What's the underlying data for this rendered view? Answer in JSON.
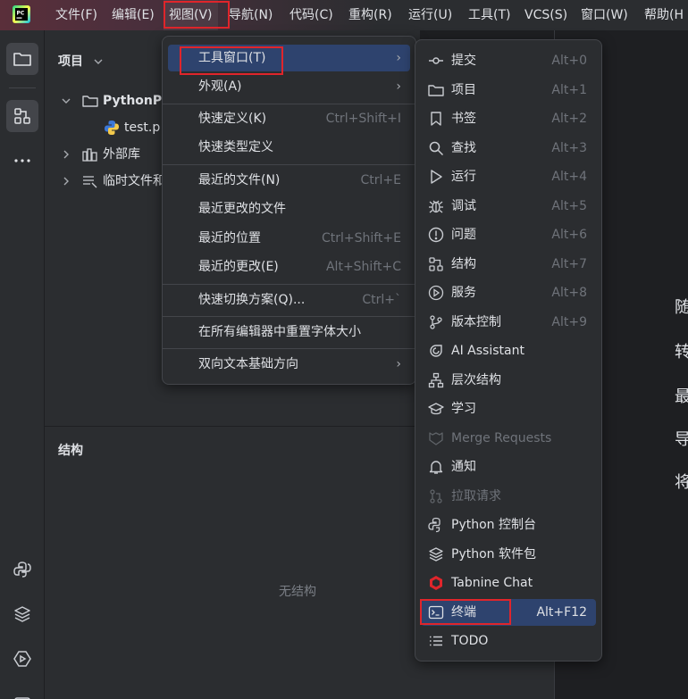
{
  "menubar": {
    "items": [
      "文件(F)",
      "编辑(E)",
      "视图(V)",
      "导航(N)",
      "代码(C)",
      "重构(R)",
      "运行(U)",
      "工具(T)",
      "VCS(S)",
      "窗口(W)",
      "帮助(H"
    ]
  },
  "project_panel": {
    "title": "项目",
    "tree": {
      "project_name": "PythonP",
      "file_name": "test.p",
      "external_libs": "外部库",
      "scratches": "临时文件和"
    }
  },
  "structure_panel": {
    "title": "结构",
    "empty_message": "无结构"
  },
  "editor_hints": [
    "随",
    "转",
    "最",
    "导",
    "将"
  ],
  "view_menu": {
    "items": [
      {
        "label": "工具窗口(T)",
        "shortcut": "",
        "submenu": true
      },
      {
        "label": "外观(A)",
        "shortcut": "",
        "submenu": true
      },
      {
        "label": "快速定义(K)",
        "shortcut": "Ctrl+Shift+I"
      },
      {
        "label": "快速类型定义",
        "shortcut": ""
      },
      {
        "label": "最近的文件(N)",
        "shortcut": "Ctrl+E"
      },
      {
        "label": "最近更改的文件",
        "shortcut": ""
      },
      {
        "label": "最近的位置",
        "shortcut": "Ctrl+Shift+E"
      },
      {
        "label": "最近的更改(E)",
        "shortcut": "Alt+Shift+C"
      },
      {
        "label": "快速切换方案(Q)...",
        "shortcut": "Ctrl+`"
      },
      {
        "label": "在所有编辑器中重置字体大小",
        "shortcut": ""
      },
      {
        "label": "双向文本基础方向",
        "shortcut": "",
        "submenu": true
      }
    ]
  },
  "tool_windows_menu": {
    "items": [
      {
        "label": "提交",
        "shortcut": "Alt+0",
        "icon": "commit-icon"
      },
      {
        "label": "项目",
        "shortcut": "Alt+1",
        "icon": "folder-icon"
      },
      {
        "label": "书签",
        "shortcut": "Alt+2",
        "icon": "bookmark-icon"
      },
      {
        "label": "查找",
        "shortcut": "Alt+3",
        "icon": "search-icon"
      },
      {
        "label": "运行",
        "shortcut": "Alt+4",
        "icon": "run-icon"
      },
      {
        "label": "调试",
        "shortcut": "Alt+5",
        "icon": "bug-icon"
      },
      {
        "label": "问题",
        "shortcut": "Alt+6",
        "icon": "problems-icon"
      },
      {
        "label": "结构",
        "shortcut": "Alt+7",
        "icon": "structure-icon"
      },
      {
        "label": "服务",
        "shortcut": "Alt+8",
        "icon": "services-icon"
      },
      {
        "label": "版本控制",
        "shortcut": "Alt+9",
        "icon": "vcs-icon"
      },
      {
        "label": "AI Assistant",
        "shortcut": "",
        "icon": "ai-assistant-icon"
      },
      {
        "label": "层次结构",
        "shortcut": "",
        "icon": "hierarchy-icon"
      },
      {
        "label": "学习",
        "shortcut": "",
        "icon": "learn-icon"
      },
      {
        "label": "Merge Requests",
        "shortcut": "",
        "icon": "merge-requests-icon",
        "disabled": true
      },
      {
        "label": "通知",
        "shortcut": "",
        "icon": "bell-icon"
      },
      {
        "label": "拉取请求",
        "shortcut": "",
        "icon": "pull-request-icon",
        "disabled": true
      },
      {
        "label": "Python 控制台",
        "shortcut": "",
        "icon": "python-console-icon"
      },
      {
        "label": "Python 软件包",
        "shortcut": "",
        "icon": "python-packages-icon"
      },
      {
        "label": "Tabnine Chat",
        "shortcut": "",
        "icon": "tabnine-icon"
      },
      {
        "label": "终端",
        "shortcut": "Alt+F12",
        "icon": "terminal-icon",
        "highlighted": true
      },
      {
        "label": "TODO",
        "shortcut": "",
        "icon": "todo-icon"
      }
    ]
  },
  "colors": {
    "highlight": "#2e436e",
    "annotation_box": "#e0252b",
    "background": "#2b2d30",
    "editor_background": "#1e1f22",
    "tabnine": "#e0252b"
  }
}
